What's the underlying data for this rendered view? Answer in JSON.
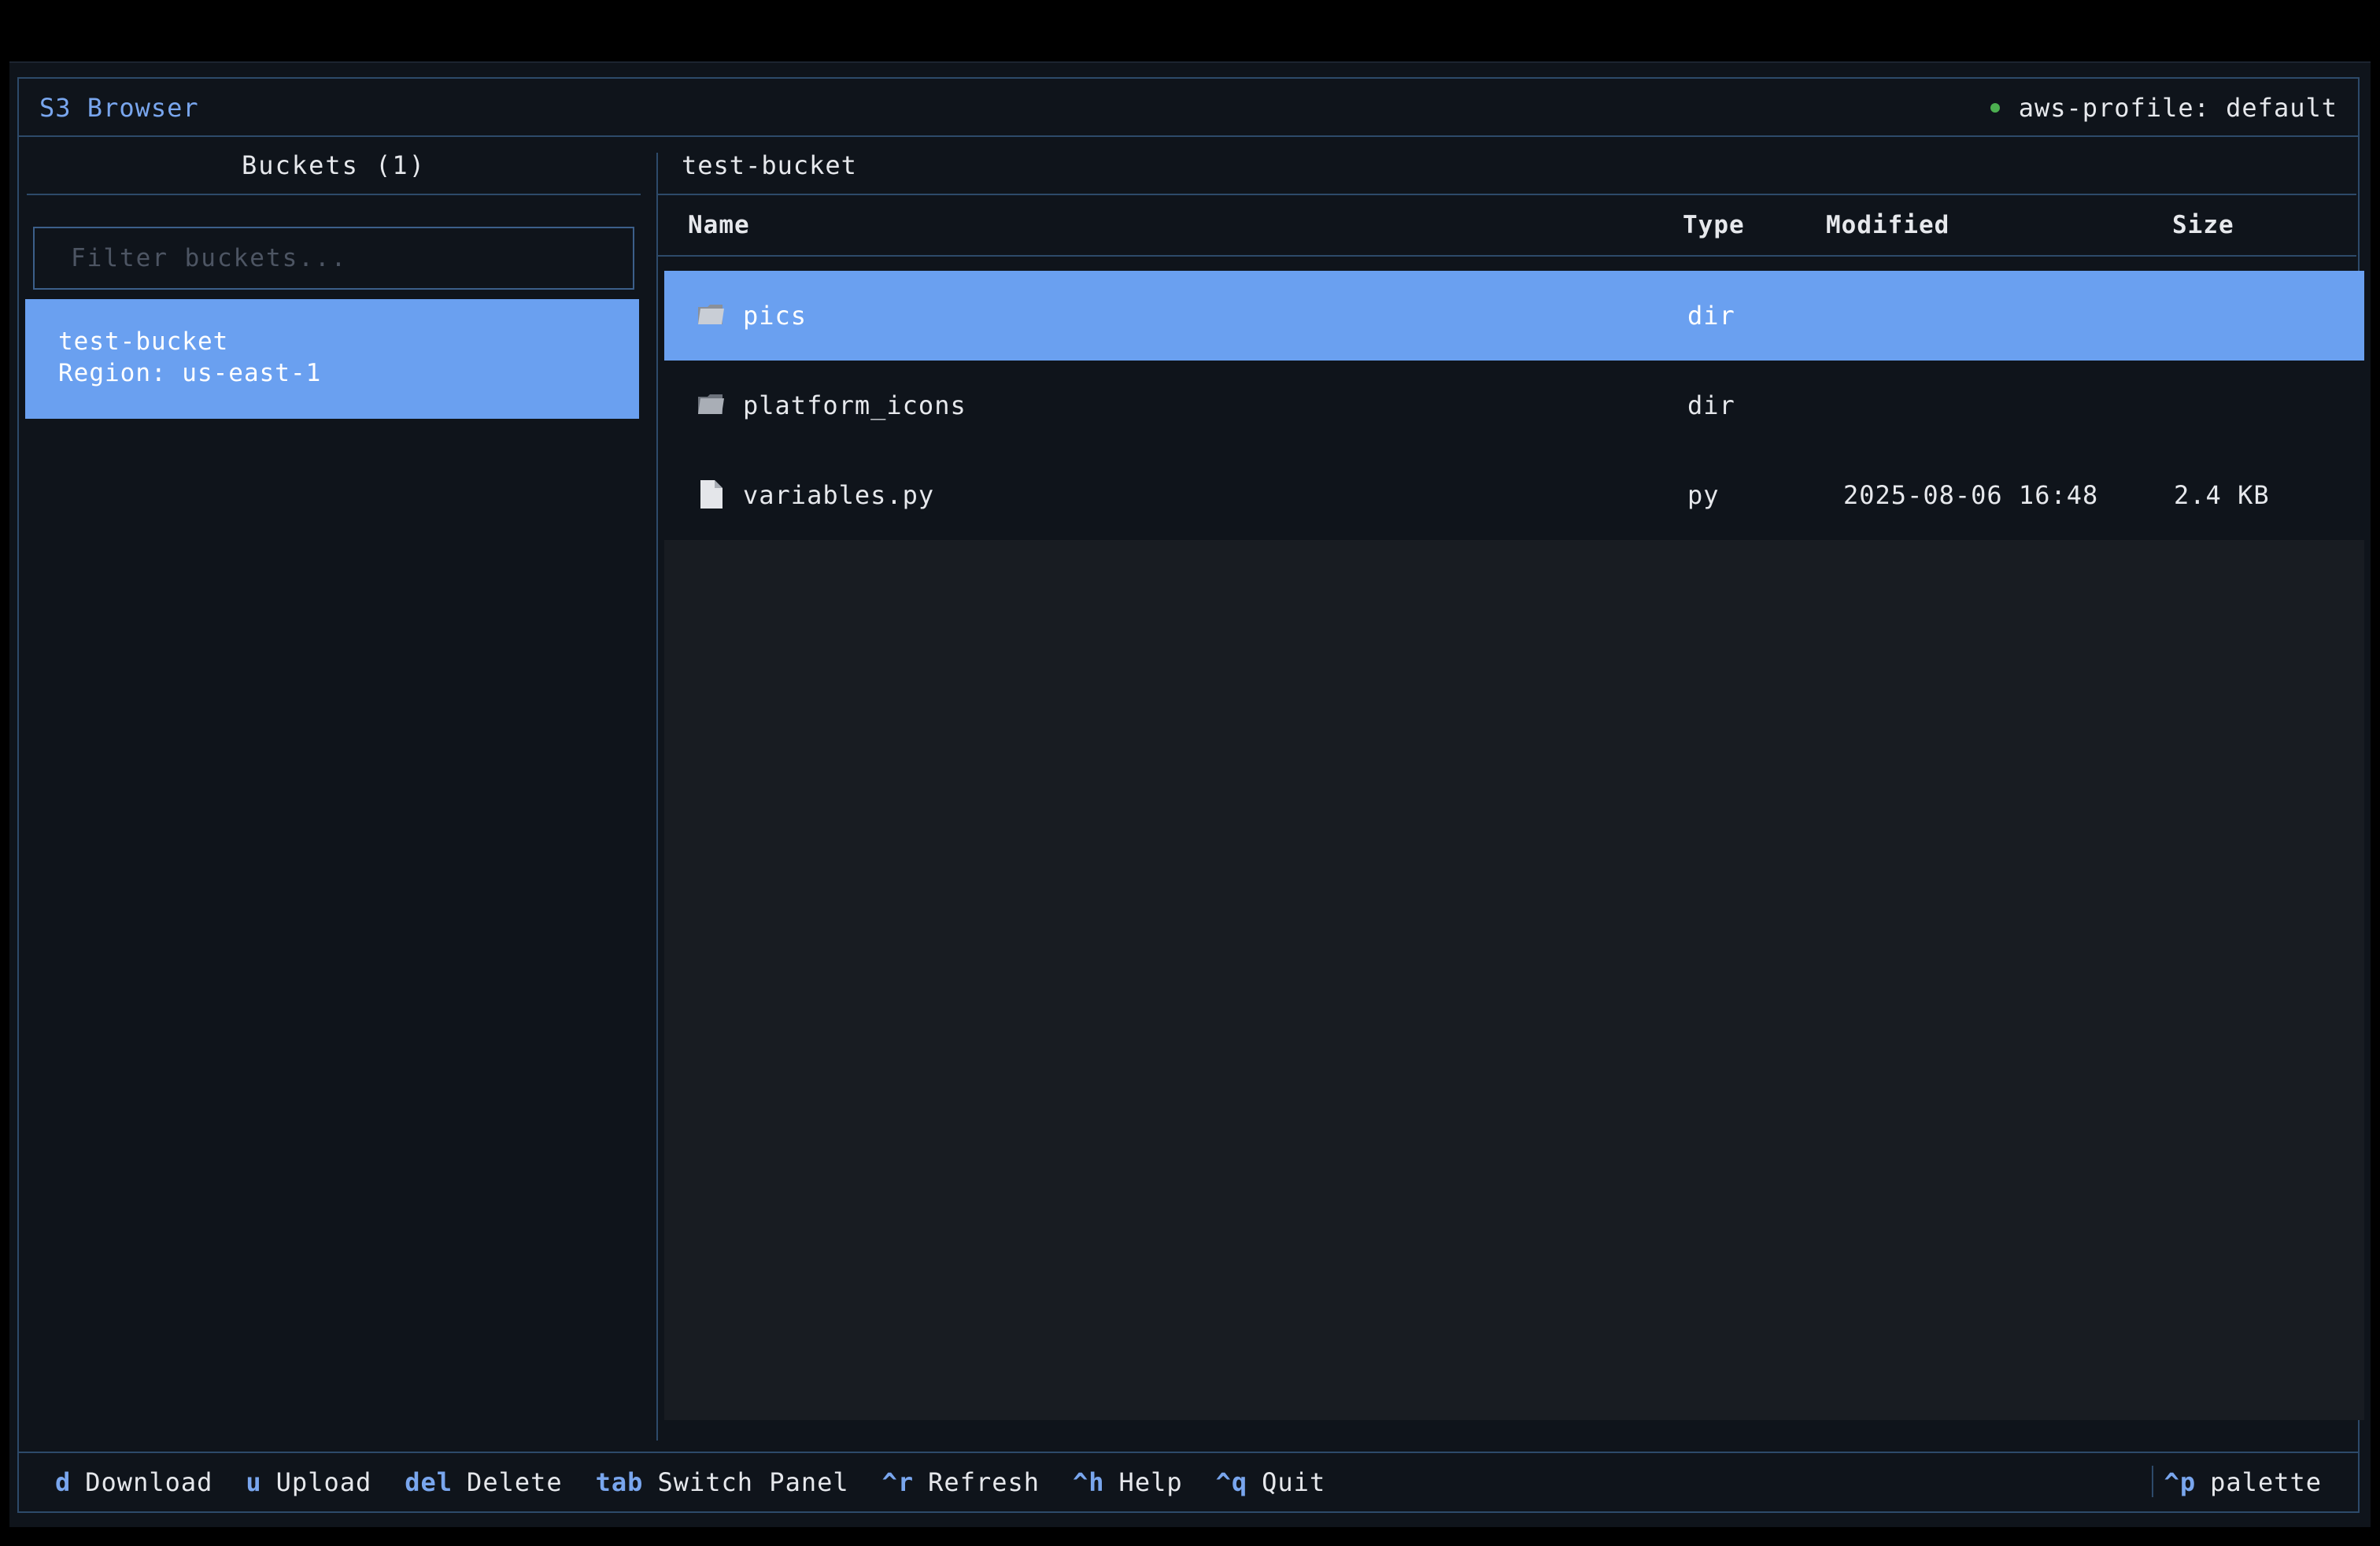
{
  "app": {
    "title": "S3 Browser",
    "profile_label": "aws-profile: default",
    "status_color": "#4caf50"
  },
  "buckets_panel": {
    "header": "Buckets (1)",
    "filter_placeholder": "Filter buckets...",
    "items": [
      {
        "name": "test-bucket",
        "region": "Region: us-east-1"
      }
    ]
  },
  "objects_panel": {
    "breadcrumb": "test-bucket",
    "columns": [
      "Name",
      "Type",
      "Modified",
      "Size"
    ],
    "rows": [
      {
        "icon": "folder-icon",
        "name": "pics",
        "type": "dir",
        "modified": "",
        "size": "",
        "selected": true
      },
      {
        "icon": "folder-icon",
        "name": "platform_icons",
        "type": "dir",
        "modified": "",
        "size": "",
        "selected": false
      },
      {
        "icon": "file-icon",
        "name": "variables.py",
        "type": "py",
        "modified": "2025-08-06 16:48",
        "size": "2.4 KB",
        "selected": false
      }
    ]
  },
  "footer": {
    "bindings": [
      {
        "key": "d",
        "label": "Download"
      },
      {
        "key": "u",
        "label": "Upload"
      },
      {
        "key": "del",
        "label": "Delete"
      },
      {
        "key": "tab",
        "label": "Switch Panel"
      },
      {
        "key": "^r",
        "label": "Refresh"
      },
      {
        "key": "^h",
        "label": "Help"
      },
      {
        "key": "^q",
        "label": "Quit"
      }
    ],
    "palette": {
      "key": "^p",
      "label": "palette"
    }
  },
  "colors": {
    "accent": "#79a6ee",
    "selection": "#6aa0f0",
    "border": "#2d4a6a",
    "background": "#0f141b"
  }
}
